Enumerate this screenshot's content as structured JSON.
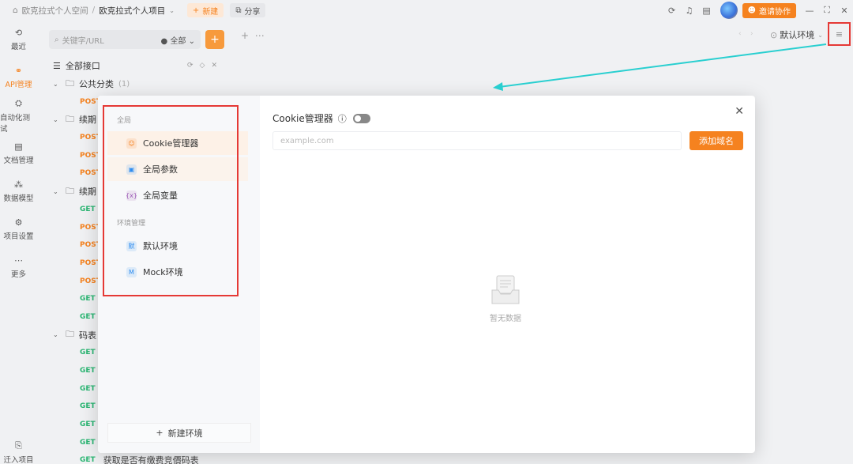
{
  "topbar": {
    "workspace": "欧克拉式个人空间",
    "separator": "/",
    "project": "欧克拉式个人项目",
    "new_label": "新建",
    "share_label": "分享",
    "invite_label": "邀请协作"
  },
  "leftnav": [
    {
      "label": "最近",
      "icon": "history-icon",
      "glyph": "⟲"
    },
    {
      "label": "API管理",
      "icon": "link-icon",
      "glyph": "⚭",
      "active": true
    },
    {
      "label": "自动化测试",
      "icon": "flow-icon",
      "glyph": "⛭"
    },
    {
      "label": "文档管理",
      "icon": "document-icon",
      "glyph": "▤"
    },
    {
      "label": "数据模型",
      "icon": "model-icon",
      "glyph": "⁂"
    },
    {
      "label": "项目设置",
      "icon": "project-settings-icon",
      "glyph": "⚙"
    },
    {
      "label": "更多",
      "icon": "more-icon",
      "glyph": "⋯"
    }
  ],
  "bottomnav": {
    "label": "迁入项目"
  },
  "sidebar": {
    "search_placeholder": "关键字/URL",
    "filter_label": "全部",
    "root_label": "全部接口",
    "groups": [
      {
        "name": "公共分类",
        "count": "(1)",
        "apis": [
          {
            "method": "POST",
            "name": ""
          }
        ]
      },
      {
        "name": "续期",
        "count": "",
        "apis": [
          {
            "method": "POST",
            "name": ""
          },
          {
            "method": "POST",
            "name": ""
          },
          {
            "method": "POST",
            "name": ""
          }
        ]
      },
      {
        "name": "续期",
        "count": "",
        "apis": [
          {
            "method": "GET",
            "name": ""
          },
          {
            "method": "POST",
            "name": ""
          },
          {
            "method": "POST",
            "name": ""
          },
          {
            "method": "POST",
            "name": ""
          },
          {
            "method": "POST",
            "name": ""
          },
          {
            "method": "GET",
            "name": ""
          },
          {
            "method": "GET",
            "name": ""
          }
        ]
      },
      {
        "name": "码表",
        "count": "",
        "apis": [
          {
            "method": "GET",
            "name": ""
          },
          {
            "method": "GET",
            "name": ""
          },
          {
            "method": "GET",
            "name": ""
          },
          {
            "method": "GET",
            "name": ""
          },
          {
            "method": "GET",
            "name": ""
          },
          {
            "method": "GET",
            "name": ""
          },
          {
            "method": "GET",
            "name": "获取是否有缴费竞價码表"
          }
        ]
      }
    ]
  },
  "env_selector": {
    "label": "默认环境"
  },
  "modal": {
    "global_section": "全局",
    "global_items": [
      {
        "label": "Cookie管理器",
        "icon": "cookie-icon",
        "glyph": "☺",
        "color": "#f5821f"
      },
      {
        "label": "全局参数",
        "icon": "params-icon",
        "glyph": "▣",
        "color": "#2d8cf0"
      },
      {
        "label": "全局变量",
        "icon": "variable-icon",
        "glyph": "{x}",
        "color": "#9b59b6"
      }
    ],
    "env_section": "环境管理",
    "env_items": [
      {
        "label": "默认环境",
        "icon": "default-env-icon",
        "glyph": "默",
        "color": "#2d8cf0"
      },
      {
        "label": "Mock环境",
        "icon": "mock-env-icon",
        "glyph": "M",
        "color": "#2d8cf0"
      }
    ],
    "new_env_label": "新建环境",
    "title": "Cookie管理器",
    "domain_placeholder": "example.com",
    "add_domain_label": "添加域名",
    "empty_text": "暂无数据"
  }
}
